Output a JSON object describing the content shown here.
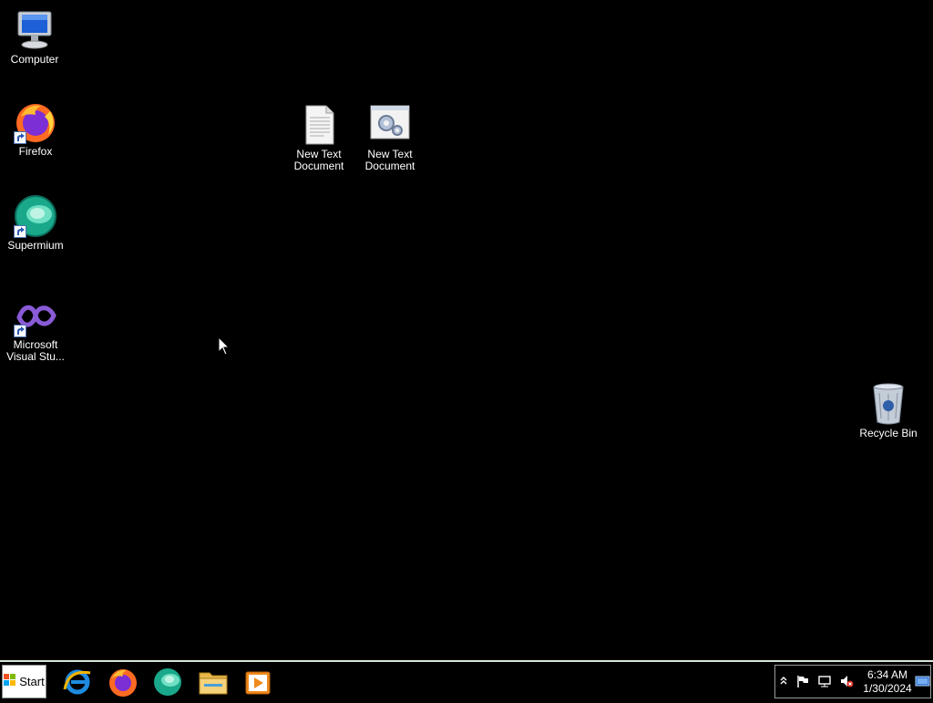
{
  "desktop": {
    "icons": [
      {
        "label": "Computer",
        "icon": "computer-icon"
      },
      {
        "label": "Firefox",
        "icon": "firefox-icon"
      },
      {
        "label": "Supermium",
        "icon": "supermium-icon"
      },
      {
        "label": "Microsoft Visual Stu...",
        "icon": "visual-studio-icon"
      },
      {
        "label": "New Text Document",
        "icon": "text-file-icon"
      },
      {
        "label": "New Text Document",
        "icon": "config-file-icon"
      },
      {
        "label": "Recycle Bin",
        "icon": "recycle-bin-icon"
      }
    ]
  },
  "taskbar": {
    "start_label": "Start",
    "pinned": [
      "internet-explorer-icon",
      "firefox-icon",
      "supermium-icon",
      "file-explorer-icon",
      "media-player-icon"
    ],
    "tray": {
      "time": "6:34 AM",
      "date": "1/30/2024",
      "icons": [
        "show-hidden-icons-chevron",
        "action-center-flag-icon",
        "network-icon",
        "volume-muted-icon",
        "show-desktop-icon"
      ]
    }
  },
  "colors": {
    "desktop_bg": "#000000",
    "taskbar_border": "#d7e7d9"
  }
}
